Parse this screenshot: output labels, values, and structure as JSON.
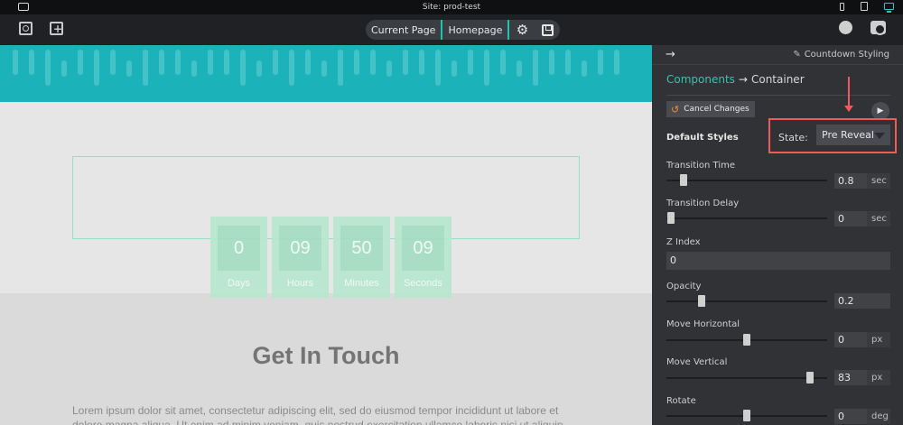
{
  "titlebar": {
    "site_title": "Site: prod-test"
  },
  "toolbar": {
    "current_page_label": "Current Page",
    "homepage_label": "Homepage",
    "settings_glyph": "⚙"
  },
  "canvas": {
    "countdown": [
      {
        "value": "0",
        "label": "Days"
      },
      {
        "value": "09",
        "label": "Hours"
      },
      {
        "value": "50",
        "label": "Minutes"
      },
      {
        "value": "09",
        "label": "Seconds"
      }
    ],
    "heading": "Get In Touch",
    "body_text": "Lorem ipsum dolor sit amet, consectetur adipiscing elit, sed do eiusmod tempor incididunt ut labore et dolore magna aliqua. Ut enim ad minim veniam, quis nostrud exercitation ullamco laboris nisi ut aliquip"
  },
  "panel": {
    "header_right": "Countdown Styling",
    "breadcrumb": {
      "components": "Components",
      "container": "Container"
    },
    "cancel_label": "Cancel Changes",
    "default_styles": "Default Styles",
    "state_label": "State:",
    "state_value": "Pre Reveal",
    "rows": {
      "transition_time": {
        "label": "Transition Time",
        "value": "0.8",
        "unit": "sec"
      },
      "transition_delay": {
        "label": "Transition Delay",
        "value": "0",
        "unit": "sec"
      },
      "z_index": {
        "label": "Z Index",
        "value": "0"
      },
      "opacity": {
        "label": "Opacity",
        "value": "0.2"
      },
      "move_horizontal": {
        "label": "Move Horizontal",
        "value": "0",
        "unit": "px"
      },
      "move_vertical": {
        "label": "Move Vertical",
        "value": "83",
        "unit": "px"
      },
      "rotate": {
        "label": "Rotate",
        "value": "0",
        "unit": "deg"
      }
    }
  },
  "colors": {
    "accent_teal": "#2cc7b3",
    "banner": "#1bb3b9",
    "highlight_red": "#f05a5a",
    "panel_bg": "#313235"
  }
}
